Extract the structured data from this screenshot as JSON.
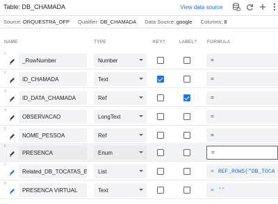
{
  "header": {
    "title": "Table: DB_CHAMADA",
    "view_source_label": "View data source",
    "icons": [
      "database-icon",
      "refresh-icon",
      "add-icon",
      "more-vert-icon"
    ]
  },
  "info": {
    "source_label": "Source:",
    "source_value": "ORQUESTRA_OFP",
    "qualifier_label": "Qualifier:",
    "qualifier_value": "DB_CHAMADA",
    "datasource_label": "Data Source:",
    "datasource_value": "google",
    "columns_label": "Columns:",
    "columns_value": "8"
  },
  "columns_header": {
    "name": "NAME",
    "type": "TYPE",
    "key": "KEY?",
    "label": "LABEL?",
    "formula": "FORMULA"
  },
  "rows": [
    {
      "num": "1",
      "name": "_RowNumber",
      "type": "Number",
      "key": false,
      "label": false,
      "formula_eq": "=",
      "formula_expr": ""
    },
    {
      "num": "2",
      "name": "ID_CHAMADA",
      "type": "Text",
      "key": true,
      "label": false,
      "formula_eq": "=",
      "formula_expr": ""
    },
    {
      "num": "3",
      "name": "ID_DATA_CHAMADA",
      "type": "Ref",
      "key": false,
      "label": true,
      "formula_eq": "=",
      "formula_expr": ""
    },
    {
      "num": "4",
      "name": "OBSERVACAO",
      "type": "LongText",
      "key": false,
      "label": false,
      "formula_eq": "=",
      "formula_expr": ""
    },
    {
      "num": "5",
      "name": "NOME_PESSOA",
      "type": "Ref",
      "key": false,
      "label": false,
      "formula_eq": "=",
      "formula_expr": ""
    },
    {
      "num": "6",
      "name": "PRESENCA",
      "type": "Enum",
      "key": false,
      "label": false,
      "formula_eq": "=",
      "formula_expr": ""
    },
    {
      "num": "7",
      "name": "Related_DB_TOCATAS_E\\",
      "type": "List",
      "key": false,
      "label": false,
      "formula_eq": "=",
      "formula_expr": "REF_ROWS(\"DB_TOCA"
    },
    {
      "num": "8",
      "name": "PRESENCA VIRTUAL",
      "type": "Text",
      "key": false,
      "label": false,
      "formula_eq": "=",
      "formula_expr": "''"
    }
  ],
  "colors": {
    "accent": "#1a73e8",
    "text": "#202124",
    "muted": "#5f6368"
  }
}
